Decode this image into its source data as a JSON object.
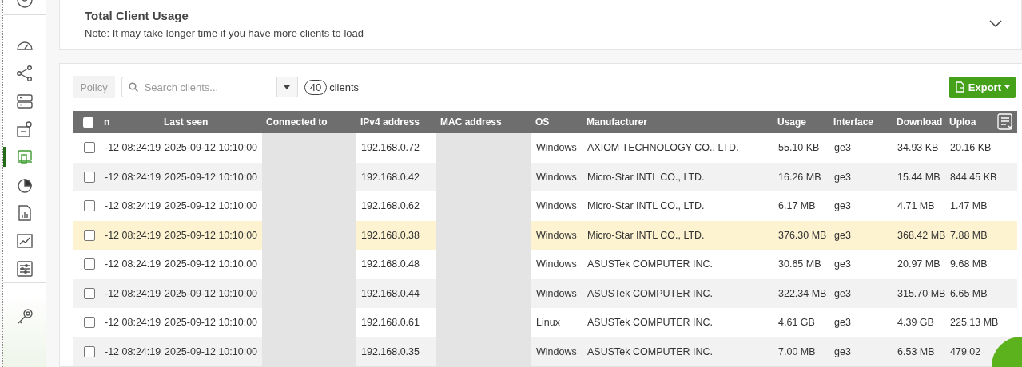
{
  "sidebar": {
    "items": [
      {
        "selected": false
      },
      {
        "selected": false
      },
      {
        "selected": false
      },
      {
        "selected": false
      },
      {
        "selected": false
      },
      {
        "selected": true
      },
      {
        "selected": false
      },
      {
        "selected": false
      },
      {
        "selected": false
      },
      {
        "selected": false
      },
      {
        "selected": false
      }
    ]
  },
  "usage_panel": {
    "title": "Total Client Usage",
    "note": "Note: It may take longer time if you have more clients to load",
    "expanded": false
  },
  "toolbar": {
    "policy_button": {
      "label": "Policy",
      "disabled": true
    },
    "search": {
      "placeholder": "Search clients..."
    },
    "count": "40",
    "count_label": "clients",
    "export_button": "Export"
  },
  "table": {
    "select_all": {
      "checked": false
    },
    "columns": [
      "n",
      "Last seen",
      "Connected to",
      "IPv4 address",
      "MAC address",
      "OS",
      "Manufacturer",
      "Usage",
      "Interface",
      "Download",
      "Uploa"
    ],
    "rows": [
      {
        "checked": false,
        "highlighted": false,
        "first_seen": "-12 08:24:19",
        "last_seen": "2025-09-12 10:10:00",
        "ipv4": "192.168.0.72",
        "os": "Windows",
        "manufacturer": "AXIOM TECHNOLOGY CO., LTD.",
        "usage": "55.10 KB",
        "interface": "ge3",
        "download": "34.93 KB",
        "upload": "20.16 KB"
      },
      {
        "checked": false,
        "highlighted": false,
        "first_seen": "-12 08:24:19",
        "last_seen": "2025-09-12 10:10:00",
        "ipv4": "192.168.0.42",
        "os": "Windows",
        "manufacturer": "Micro-Star INTL CO., LTD.",
        "usage": "16.26 MB",
        "interface": "ge3",
        "download": "15.44 MB",
        "upload": "844.45 KB"
      },
      {
        "checked": false,
        "highlighted": false,
        "first_seen": "-12 08:24:19",
        "last_seen": "2025-09-12 10:10:00",
        "ipv4": "192.168.0.62",
        "os": "Windows",
        "manufacturer": "Micro-Star INTL CO., LTD.",
        "usage": "6.17 MB",
        "interface": "ge3",
        "download": "4.71 MB",
        "upload": "1.47 MB"
      },
      {
        "checked": false,
        "highlighted": true,
        "first_seen": "-12 08:24:19",
        "last_seen": "2025-09-12 10:10:00",
        "ipv4": "192.168.0.38",
        "os": "Windows",
        "manufacturer": "Micro-Star INTL CO., LTD.",
        "usage": "376.30 MB",
        "interface": "ge3",
        "download": "368.42 MB",
        "upload": "7.88 MB"
      },
      {
        "checked": false,
        "highlighted": false,
        "first_seen": "-12 08:24:19",
        "last_seen": "2025-09-12 10:10:00",
        "ipv4": "192.168.0.48",
        "os": "Windows",
        "manufacturer": "ASUSTek COMPUTER INC.",
        "usage": "30.65 MB",
        "interface": "ge3",
        "download": "20.97 MB",
        "upload": "9.68 MB"
      },
      {
        "checked": false,
        "highlighted": false,
        "first_seen": "-12 08:24:19",
        "last_seen": "2025-09-12 10:10:00",
        "ipv4": "192.168.0.44",
        "os": "Windows",
        "manufacturer": "ASUSTek COMPUTER INC.",
        "usage": "322.34 MB",
        "interface": "ge3",
        "download": "315.70 MB",
        "upload": "6.65 MB"
      },
      {
        "checked": false,
        "highlighted": false,
        "first_seen": "-12 08:24:19",
        "last_seen": "2025-09-12 10:10:00",
        "ipv4": "192.168.0.61",
        "os": "Linux",
        "manufacturer": "ASUSTek COMPUTER INC.",
        "usage": "4.61 GB",
        "interface": "ge3",
        "download": "4.39 GB",
        "upload": "225.13 MB"
      },
      {
        "checked": false,
        "highlighted": false,
        "first_seen": "-12 08:24:19",
        "last_seen": "2025-09-12 10:10:00",
        "ipv4": "192.168.0.35",
        "os": "Windows",
        "manufacturer": "ASUSTek COMPUTER INC.",
        "usage": "7.00 MB",
        "interface": "ge3",
        "download": "6.53 MB",
        "upload": "479.02"
      }
    ]
  }
}
